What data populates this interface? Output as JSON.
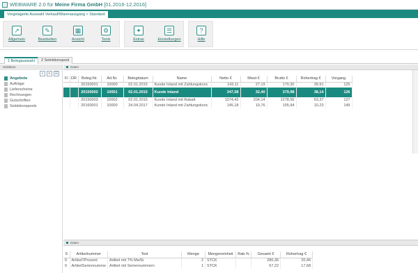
{
  "titlebar": {
    "app": "WEBWARE 2.0 für",
    "company": "Meine Firma GmbH",
    "period": "[01.2016-12.2016]"
  },
  "doc_tab": "Vorgelagerte Auswahl Verkauf/Warenausgang > Standard",
  "ribbon": {
    "items": [
      {
        "label": "Allgemein",
        "icon": "arrow-icon"
      },
      {
        "label": "Bearbeiten",
        "icon": "edit-icon"
      },
      {
        "label": "Ansicht",
        "icon": "view-icon"
      },
      {
        "label": "Tools",
        "icon": "gear-icon"
      },
      {
        "label": "Extras",
        "icon": "extras-icon"
      },
      {
        "label": "Einstellungen",
        "icon": "settings-icon"
      },
      {
        "label": "Hilfe",
        "icon": "help-icon"
      }
    ]
  },
  "view_tabs": {
    "tab1": "1 Belegauswahl",
    "tab2": "2 Selektionspool"
  },
  "left_panel": {
    "header": "Selektion",
    "items": [
      "Angebote",
      "Aufträge",
      "Lieferscheine",
      "Rechnungen",
      "Gutschriften",
      "Selektionspools"
    ]
  },
  "main_section": {
    "header": "Daten",
    "columns": [
      "Fi",
      "DR",
      "Beleg-Nr.",
      "Ad.Nr.",
      "Belegdatum",
      "Name",
      "Netto €",
      "Mwst €",
      "Brutto €",
      "Rohertrag €",
      "Vorgang"
    ],
    "rows": [
      {
        "fi": "",
        "dr": "",
        "beleg": "20150001",
        "adnr": "10000",
        "datum": "02.01.2015",
        "name": "Kunde Inland mit Zahlungskonc",
        "netto": "143,11",
        "mwst": "27,19",
        "brutto": "170,30",
        "rohertrag": "39,91",
        "vorgang": "125"
      },
      {
        "fi": "",
        "dr": "",
        "beleg": "20150002",
        "adnr": "10001",
        "datum": "02.01.2015",
        "name": "Kunde Inland",
        "netto": "347,58",
        "mwst": "32,40",
        "brutto": "379,98",
        "rohertrag": "38,14",
        "vorgang": "126"
      },
      {
        "fi": "",
        "dr": "",
        "beleg": "20150003",
        "adnr": "10002",
        "datum": "02.01.2015",
        "name": "Kunde Inland mit Rabatt",
        "netto": "1074,42",
        "mwst": "204,14",
        "brutto": "1278,56",
        "rohertrag": "63,37",
        "vorgang": "127"
      },
      {
        "fi": "",
        "dr": "",
        "beleg": "20160001",
        "adnr": "10000",
        "datum": "24.04.2017",
        "name": "Kunde Inland mit Zahlungskonc",
        "netto": "145,18",
        "mwst": "10,76",
        "brutto": "155,94",
        "rohertrag": "10,23",
        "vorgang": "149"
      }
    ]
  },
  "bottom_section": {
    "header": "Daten",
    "columns": [
      "S",
      "Artikelnummer",
      "Text",
      "Menge",
      "Mengeneinheit",
      "Rab.%",
      "Gesamt €",
      "Rohertrag €"
    ],
    "rows": [
      {
        "s": "0",
        "artnr": "Artikel7Prozent",
        "text": "Artikel mit 7% MwSt.",
        "menge": "2",
        "einheit": "STCK",
        "rab": "",
        "gesamt": "280,36",
        "rohertrag": "20,46"
      },
      {
        "s": "0",
        "artnr": "ArtikelSeriennumme",
        "text": "Artikel mit Seriennummern",
        "menge": "1",
        "einheit": "STCK",
        "rab": "",
        "gesamt": "67,22",
        "rohertrag": "17,68"
      }
    ]
  },
  "colors": {
    "accent": "#1a8a80",
    "selected_row": "#1a8a80"
  }
}
